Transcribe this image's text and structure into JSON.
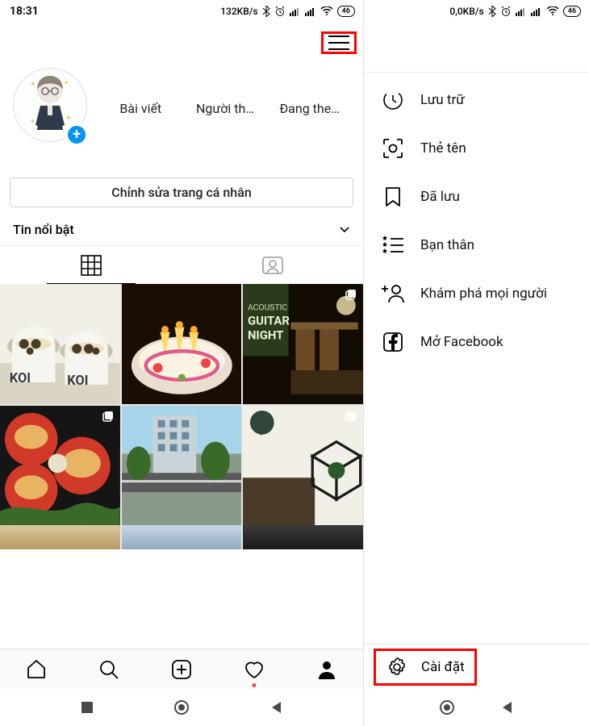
{
  "left": {
    "status": {
      "time": "18:31",
      "speed": "132KB/s",
      "battery": "46"
    },
    "stats": {
      "posts": "Bài viết",
      "followers": "Người th…",
      "following": "Đang the…"
    },
    "edit_profile": "Chỉnh sửa trang cá nhân",
    "highlights": "Tin nổi bật"
  },
  "right": {
    "status": {
      "speed": "0,0KB/s",
      "battery": "46"
    },
    "menu": {
      "archive": "Lưu trữ",
      "nametag": "Thẻ tên",
      "saved": "Đã lưu",
      "close_friends": "Bạn thân",
      "discover": "Khám phá mọi người",
      "open_fb": "Mở Facebook"
    },
    "settings": "Cài đặt"
  }
}
